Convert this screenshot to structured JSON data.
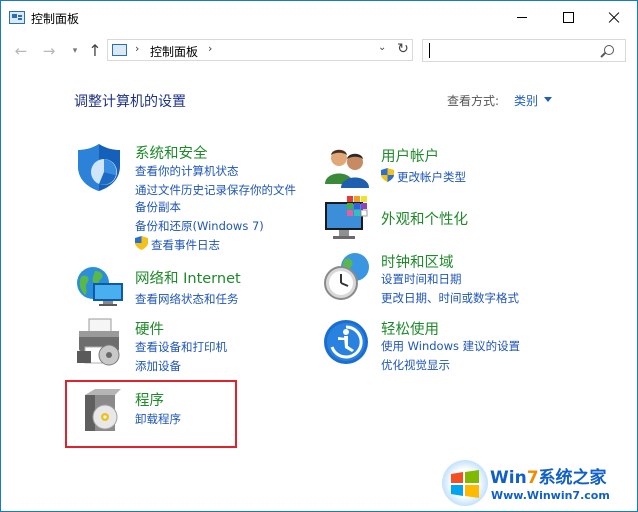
{
  "window": {
    "title": "控制面板"
  },
  "nav": {
    "breadcrumb_separator": "›",
    "breadcrumb": "控制面板"
  },
  "header": {
    "heading": "调整计算机的设置",
    "view_by_label": "查看方式:",
    "view_by_value": "类别"
  },
  "categories": {
    "system": {
      "title": "系统和安全",
      "links": [
        "查看你的计算机状态",
        "通过文件历史记录保存你的文件",
        "备份副本",
        "备份和还原(Windows 7)",
        "查看事件日志"
      ]
    },
    "network": {
      "title": "网络和 Internet",
      "links": [
        "查看网络状态和任务"
      ]
    },
    "hardware": {
      "title": "硬件",
      "links": [
        "查看设备和打印机",
        "添加设备"
      ]
    },
    "programs": {
      "title": "程序",
      "links": [
        "卸载程序"
      ]
    },
    "user": {
      "title": "用户帐户",
      "links": [
        "更改帐户类型"
      ]
    },
    "appearance": {
      "title": "外观和个性化",
      "links": []
    },
    "clock": {
      "title": "时钟和区域",
      "links": [
        "设置时间和日期",
        "更改日期、时间或数字格式"
      ]
    },
    "ease": {
      "title": "轻松使用",
      "links": [
        "使用 Windows 建议的设置",
        "优化视觉显示"
      ]
    }
  },
  "watermark": {
    "title_prefix": "Win",
    "title_seven": "7",
    "title_suffix": "系统之家",
    "url": "Www.Winwin7.com"
  },
  "colors": {
    "category_title": "#1e8a2a",
    "link": "#1f56b8",
    "heading": "#1e3287",
    "highlight": "#e0222a",
    "window_border": "#1979ca"
  }
}
